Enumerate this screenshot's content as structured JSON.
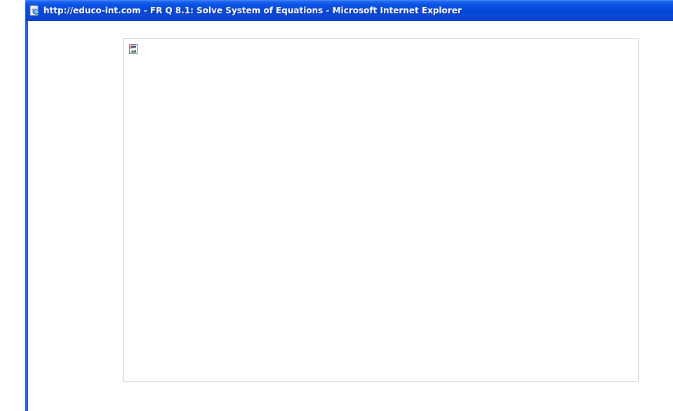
{
  "window": {
    "title": "http://educo-int.com - FR Q 8.1: Solve System of Equations - Microsoft Internet Explorer",
    "title_icon": "ie-page-icon",
    "accent_color": "#0a54e6"
  },
  "content": {
    "image_placeholder_icon": "broken-image-icon",
    "border_color": "#c9c9c9"
  }
}
